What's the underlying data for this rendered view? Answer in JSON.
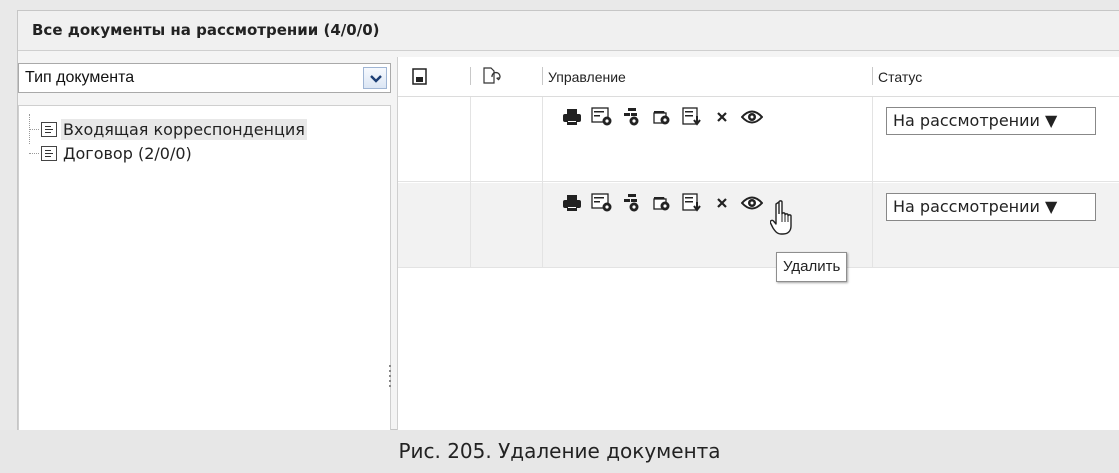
{
  "panel": {
    "title": "Все документы на рассмотрении (4/0/0)"
  },
  "filter": {
    "selected": "Тип документа"
  },
  "tree": {
    "items": [
      {
        "label": "Входящая корреспонденция"
      },
      {
        "label": "Договор (2/0/0)"
      }
    ]
  },
  "grid": {
    "columns": {
      "management": "Управление",
      "status": "Статус"
    },
    "rows": [
      {
        "status": "На рассмотрении ▼"
      },
      {
        "status": "На рассмотрении ▼"
      }
    ]
  },
  "tooltip": {
    "text": "Удалить"
  },
  "caption": {
    "text": "Рис. 205. Удаление документа"
  },
  "icons": [
    "print-icon",
    "view-card-icon",
    "route-icon",
    "history-icon",
    "export-icon",
    "delete-icon",
    "eye-icon"
  ]
}
